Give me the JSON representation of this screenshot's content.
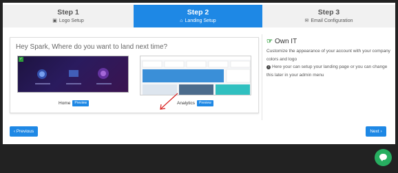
{
  "steps": [
    {
      "title": "Step 1",
      "subtitle": "Logo Setup",
      "icon": "image-icon",
      "active": false
    },
    {
      "title": "Step 2",
      "subtitle": "Landing Setup",
      "icon": "home-icon",
      "active": true
    },
    {
      "title": "Step 3",
      "subtitle": "Email Configuration",
      "icon": "envelope-icon",
      "active": false
    }
  ],
  "main": {
    "prompt": "Hey Spark, Where do you want to land next time?",
    "options": [
      {
        "label": "Home",
        "badge": "Preview",
        "selected": true
      },
      {
        "label": "Analytics",
        "badge": "Preview",
        "selected": false
      }
    ]
  },
  "sidebar": {
    "title": "Own IT",
    "line1": "Customize the appearance of your account with your company colors and logo",
    "line2": "Here your can setup your landing page or you can change this later in your admin menu"
  },
  "nav": {
    "previous": "‹ Previous",
    "next": "Next ›"
  },
  "colors": {
    "accent": "#1e88e5",
    "success": "#2e9d3a",
    "chat": "#27ae60"
  }
}
